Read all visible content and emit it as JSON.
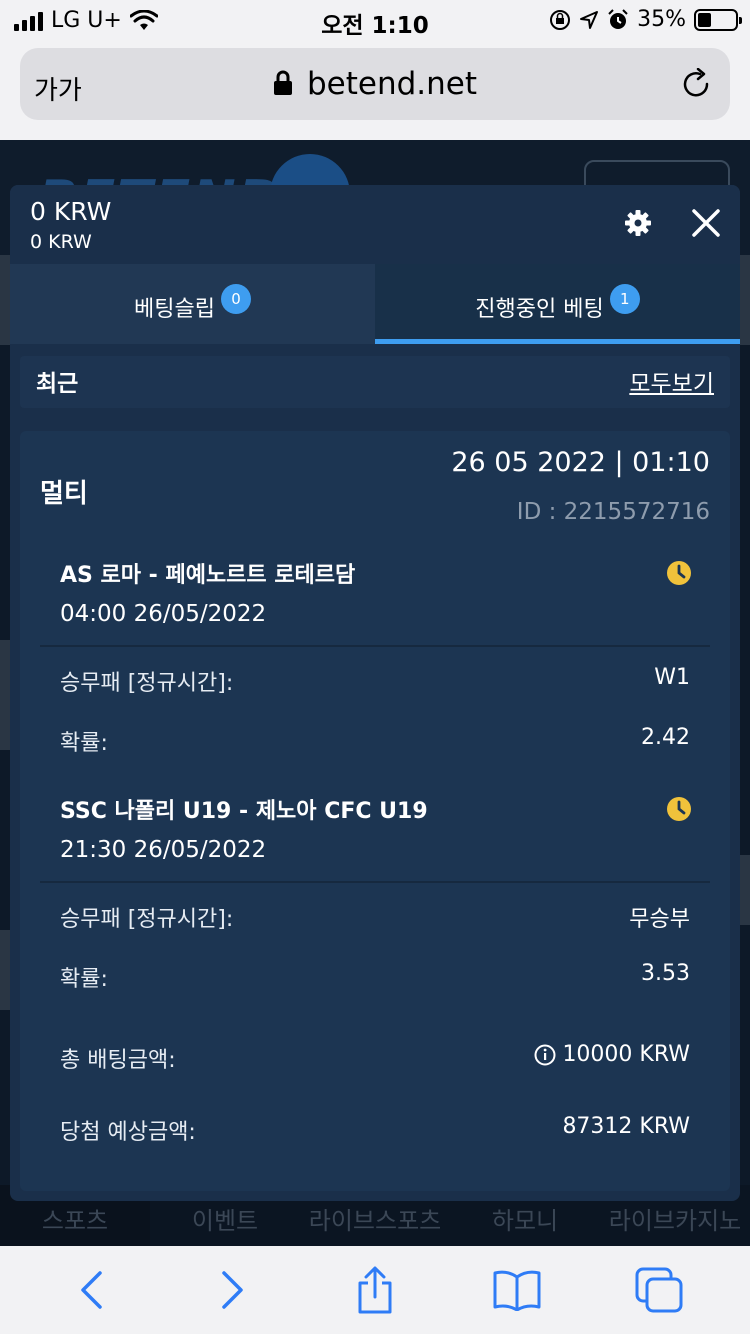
{
  "status_bar": {
    "carrier": "LG U+",
    "time": "오전 1:10",
    "battery": "35%"
  },
  "browser": {
    "text_size_label": "가가",
    "url": "betend.net"
  },
  "site": {
    "nav": [
      "스포츠",
      "이벤트",
      "라이브스포츠",
      "하모니",
      "라이브카지노"
    ]
  },
  "modal": {
    "balance_main": "0 KRW",
    "balance_sub": "0 KRW",
    "tabs": [
      {
        "label": "베팅슬립",
        "badge": "0"
      },
      {
        "label": "진행중인 베팅",
        "badge": "1"
      }
    ],
    "recent_label": "최근",
    "view_all_label": "모두보기",
    "bet": {
      "type": "멀티",
      "date": "26 05 2022 | 01:10",
      "id": "ID : 2215572716",
      "events": [
        {
          "title": "AS 로마 - 페예노르트 로테르담",
          "time": "04:00   26/05/2022",
          "market_label": "승무패 [정규시간]:",
          "market_value": "W1",
          "odds_label": "확률:",
          "odds_value": "2.42"
        },
        {
          "title": "SSC 나폴리 U19 - 제노아 CFC U19",
          "time": "21:30   26/05/2022",
          "market_label": "승무패 [정규시간]:",
          "market_value": "무승부",
          "odds_label": "확률:",
          "odds_value": "3.53"
        }
      ],
      "stake_label": "총 배팅금액:",
      "stake_value": "10000 KRW",
      "payout_label": "당첨 예상금액:",
      "payout_value": "87312 KRW"
    }
  },
  "colors": {
    "accent": "#3e9df0",
    "clock": "#f0c23b",
    "modal_bg": "#1a2f4a"
  }
}
